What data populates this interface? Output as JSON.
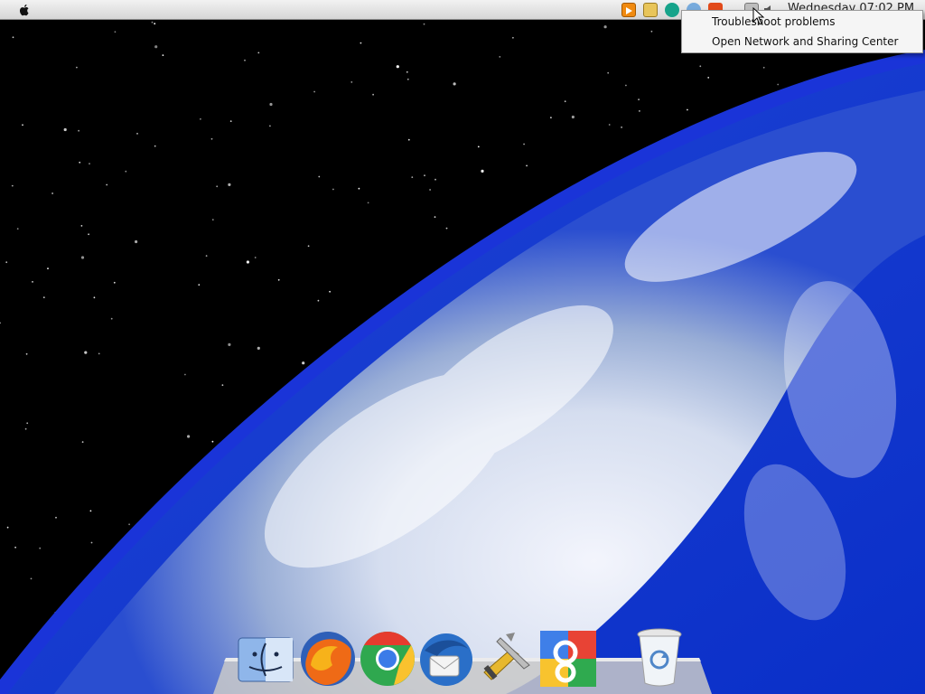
{
  "desktop": {
    "wallpaper": "earth-from-space",
    "colors": {
      "space": "#000000",
      "ocean": "#1a3fc8",
      "cloud": "#eef2f8"
    }
  },
  "menubar": {
    "apple_icon": "apple-logo-icon",
    "tray_icons": [
      "media-player-icon",
      "folder-icon",
      "messenger-icon",
      "globe-icon",
      "office-icon",
      "network-icon",
      "volume-icon"
    ],
    "clock": "Wednesday 07:02 PM"
  },
  "context_menu": {
    "items": [
      {
        "label": "Troubleshoot problems"
      },
      {
        "label": "Open Network and Sharing Center"
      }
    ]
  },
  "dock": {
    "items": [
      {
        "name": "Finder",
        "icon": "finder-icon"
      },
      {
        "name": "Firefox",
        "icon": "firefox-icon"
      },
      {
        "name": "Google Chrome",
        "icon": "chrome-icon"
      },
      {
        "name": "Thunderbird",
        "icon": "thunderbird-icon"
      },
      {
        "name": "Tools",
        "icon": "tools-icon"
      },
      {
        "name": "Google",
        "icon": "google-icon"
      },
      {
        "name": "Recycle Bin",
        "icon": "recycle-bin-icon"
      }
    ]
  }
}
